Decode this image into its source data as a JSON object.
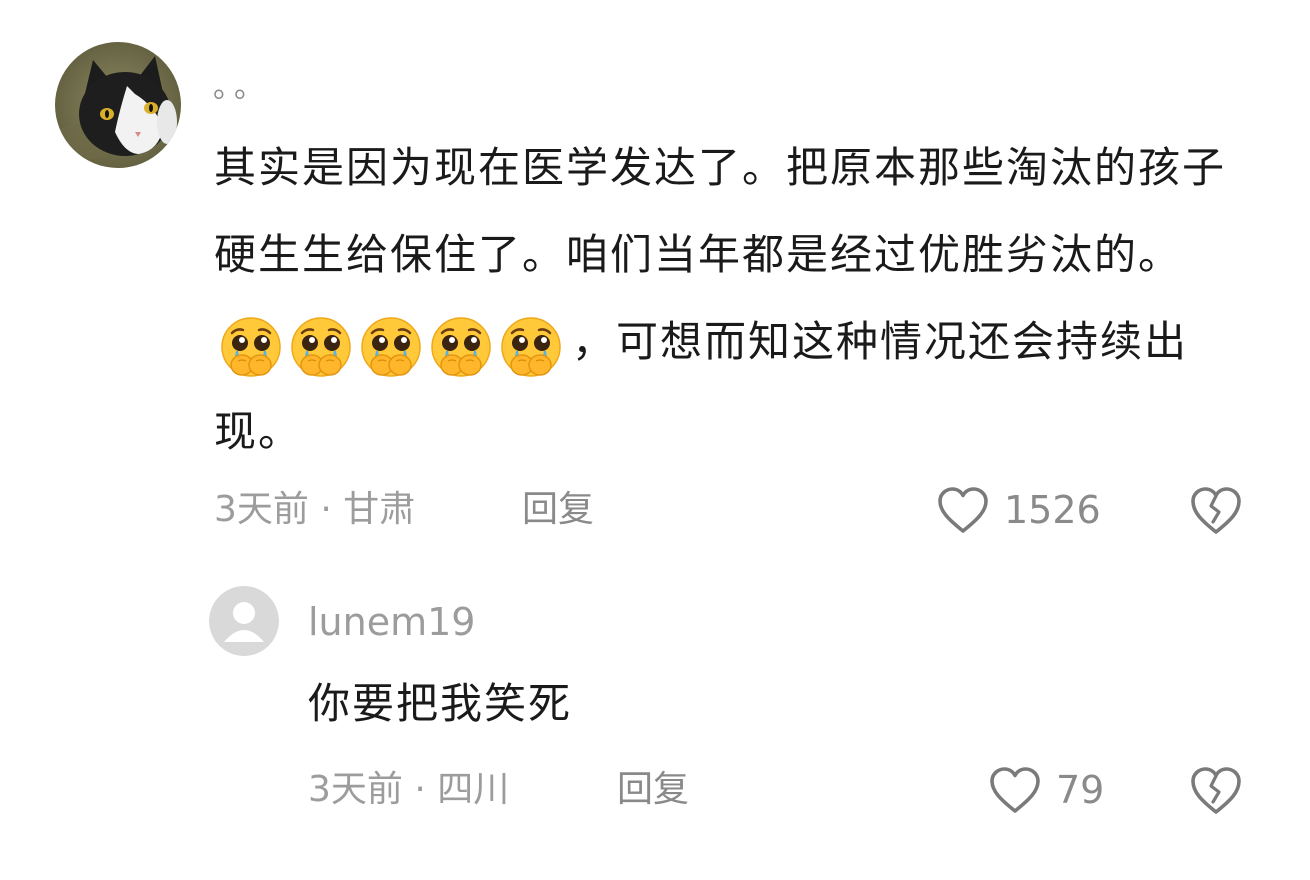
{
  "comment": {
    "username": "。。",
    "text_before_emoji": "其实是因为现在医学发达了。把原本那些淘汰的孩子硬生生给保住了。咱们当年都是经过优胜劣汰的。",
    "emoji_icons": [
      "pleading-cry-emoji",
      "pleading-cry-emoji",
      "pleading-cry-emoji",
      "pleading-cry-emoji",
      "pleading-cry-emoji"
    ],
    "text_after_emoji": "，可想而知这种情况还会持续出现。",
    "meta": "3天前 · 甘肃",
    "reply_label": "回复",
    "like_count": "1526"
  },
  "reply": {
    "username": "lunem19",
    "text": "你要把我笑死",
    "meta": "3天前 · 四川",
    "reply_label": "回复",
    "like_count": "79"
  },
  "colors": {
    "text": "#1a1a1a",
    "meta": "#9c9c9c",
    "icon": "#7a7a7a",
    "background": "#ffffff"
  }
}
